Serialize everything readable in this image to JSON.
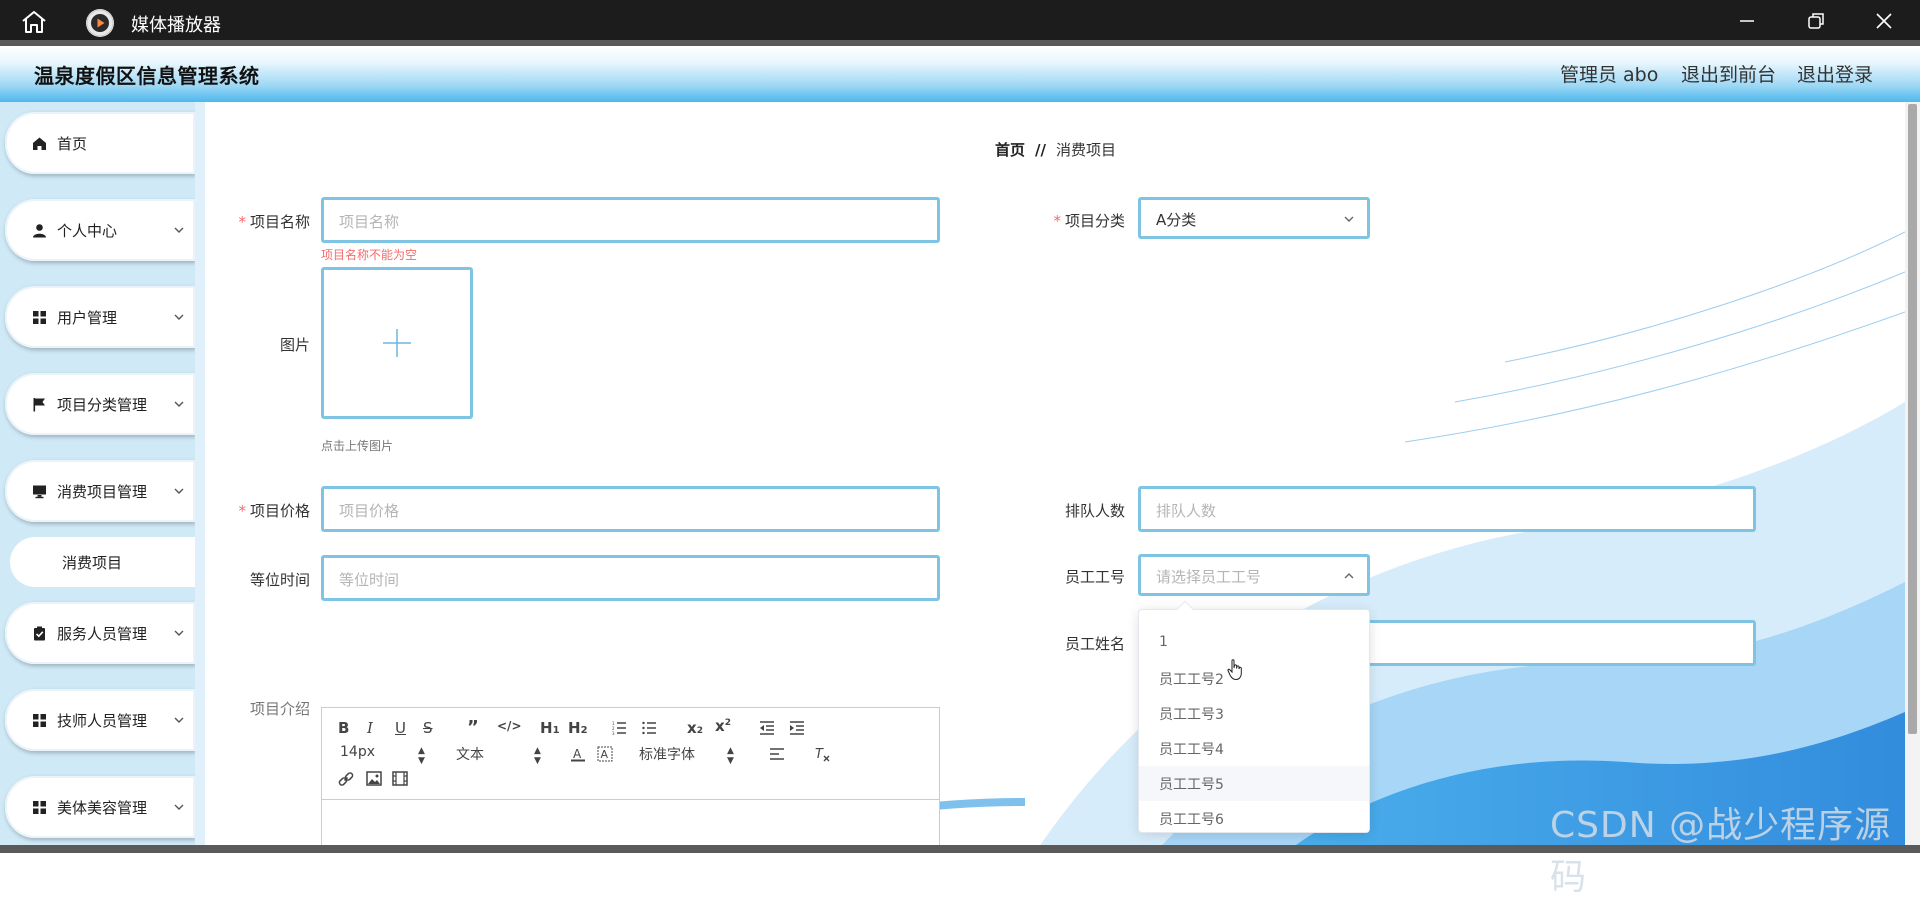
{
  "window": {
    "app_title": "媒体播放器"
  },
  "header": {
    "system_title": "温泉度假区信息管理系统",
    "admin_label": "管理员 abo",
    "front_label": "退出到前台",
    "logout_label": "退出登录"
  },
  "sidebar": {
    "items": [
      {
        "label": "首页",
        "icon": "home-icon"
      },
      {
        "label": "个人中心",
        "icon": "person-icon"
      },
      {
        "label": "用户管理",
        "icon": "grid-icon"
      },
      {
        "label": "项目分类管理",
        "icon": "flag-icon"
      },
      {
        "label": "消费项目管理",
        "icon": "monitor-icon"
      },
      {
        "label": "服务人员管理",
        "icon": "clipboard-icon"
      },
      {
        "label": "技师人员管理",
        "icon": "grid-icon"
      },
      {
        "label": "美体美容管理",
        "icon": "grid-icon"
      }
    ],
    "submenu": {
      "label": "消费项目"
    }
  },
  "breadcrumb": {
    "home": "首页",
    "separator": "//",
    "current": "消费项目"
  },
  "form": {
    "name": {
      "label": "项目名称",
      "placeholder": "项目名称",
      "error": "项目名称不能为空"
    },
    "category": {
      "label": "项目分类",
      "value": "A分类"
    },
    "image": {
      "label": "图片",
      "hint": "点击上传图片"
    },
    "price": {
      "label": "项目价格",
      "placeholder": "项目价格"
    },
    "queue": {
      "label": "排队人数",
      "placeholder": "排队人数"
    },
    "wait": {
      "label": "等位时间",
      "placeholder": "等位时间"
    },
    "staff_id": {
      "label": "员工工号",
      "placeholder": "请选择员工工号"
    },
    "staff_name": {
      "label": "员工姓名"
    },
    "intro": {
      "label": "项目介绍"
    }
  },
  "dropdown": {
    "options": [
      "1",
      "员工工号2",
      "员工工号3",
      "员工工号4",
      "员工工号5",
      "员工工号6"
    ],
    "hovered_index": 4
  },
  "editor": {
    "font_size": "14px",
    "block_type": "文本",
    "font_family": "标准字体"
  },
  "watermark": "CSDN @战少程序源码",
  "colors": {
    "accent_border": "#7fc4e3",
    "header_gradient_end": "#4db8ee",
    "sidebar_bg": "#cfe9f7",
    "error": "#f56c6c"
  }
}
